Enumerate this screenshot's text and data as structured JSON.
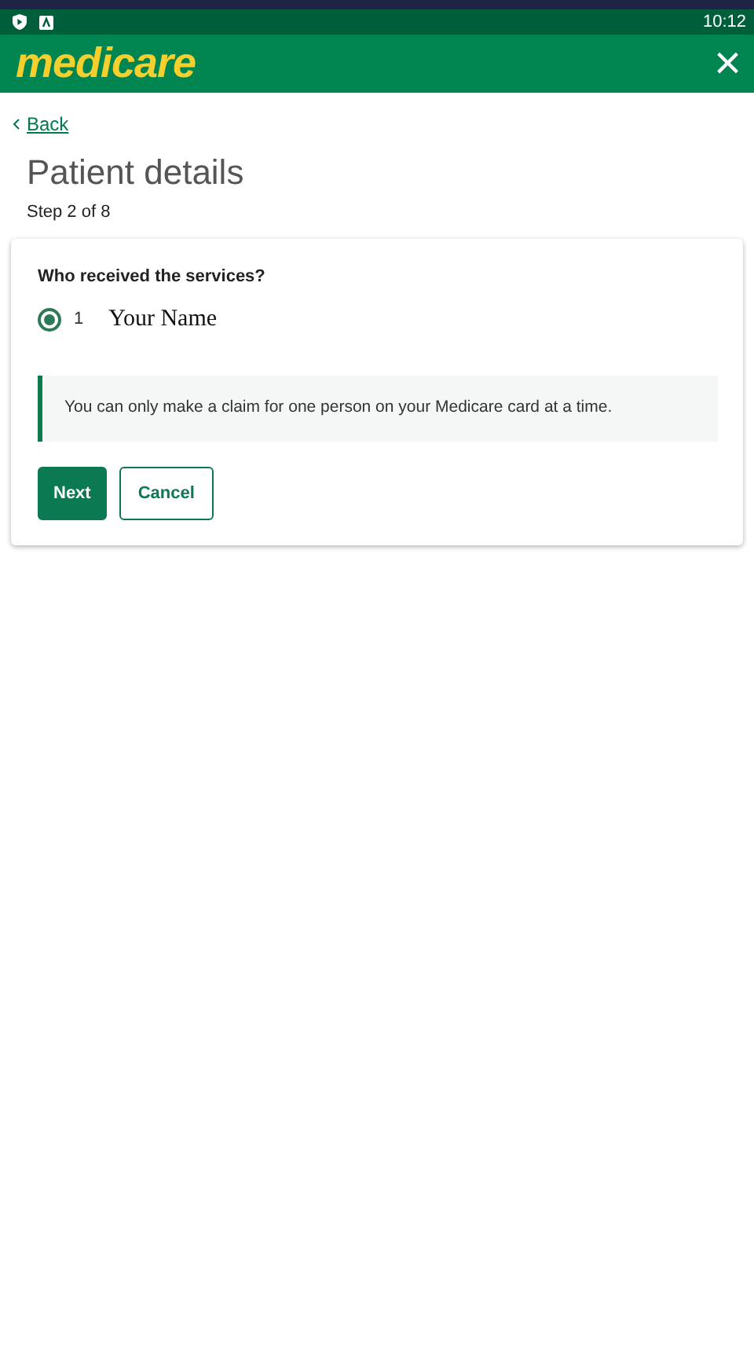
{
  "status_bar": {
    "time": "10:12"
  },
  "header": {
    "logo": "medicare",
    "close": "×"
  },
  "back_link": "Back",
  "title": "Patient details",
  "step": "Step 2 of 8",
  "question": "Who received the services?",
  "options": [
    {
      "number": "1",
      "label": "Your Name",
      "selected": true
    }
  ],
  "notice": "You can only make a claim for one person on your Medicare card at a time.",
  "buttons": [
    {
      "label": "Next",
      "kind": "primary"
    },
    {
      "label": "Cancel",
      "kind": "outline"
    }
  ]
}
